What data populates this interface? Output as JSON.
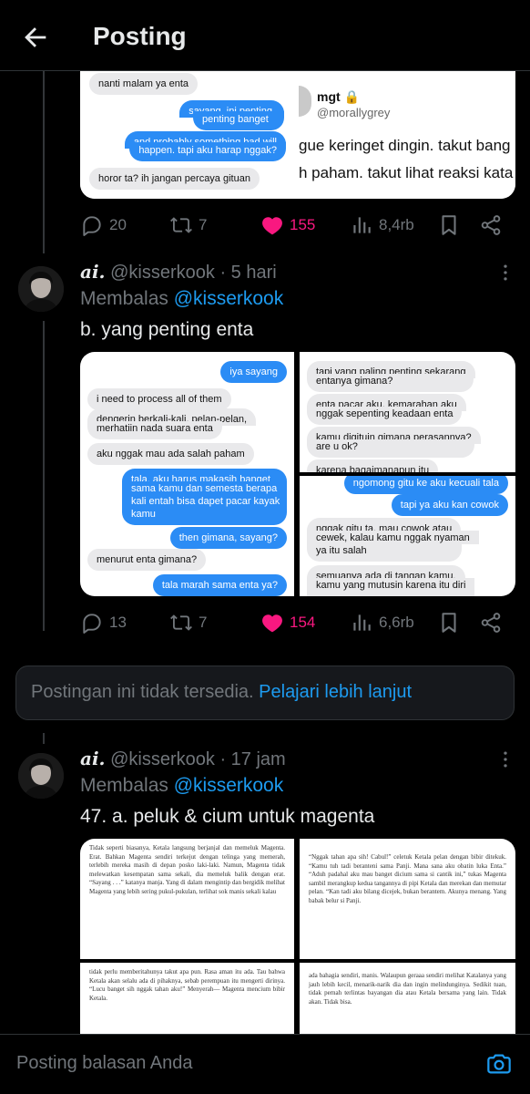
{
  "header": {
    "title": "Posting"
  },
  "post1": {
    "media_left": [
      {
        "side": "l",
        "text": "nanti malam ya enta"
      },
      {
        "side": "r",
        "text": "sayang, ini penting."
      },
      {
        "side": "r",
        "text": "penting banget"
      },
      {
        "side": "r",
        "text": "and probably something bad will"
      },
      {
        "side": "r",
        "text": "happen. tapi aku harap nggak?"
      },
      {
        "side": "l",
        "text": "horor ta? ih jangan percaya gituan"
      }
    ],
    "media_right": {
      "name": "mgt",
      "handle": "@morallygrey",
      "line1": "gue keringet dingin. takut bang",
      "line2": "h paham. takut lihat reaksi kata"
    },
    "replies": "20",
    "reposts": "7",
    "likes": "155",
    "views": "8,4rb"
  },
  "post2": {
    "name": "ai.",
    "handle": "@kisserkook",
    "time": "· 5 hari",
    "reply_label": "Membalas",
    "reply_mention": "@kisserkook",
    "text": "b. yang penting enta",
    "media_left": [
      {
        "side": "r",
        "text": "iya sayang"
      },
      {
        "side": "l",
        "text": "i need to process all of them"
      },
      {
        "side": "l",
        "text": "dengerin berkali-kali, pelan-pelan,"
      },
      {
        "side": "l",
        "text": "merhatiin nada suara enta"
      },
      {
        "side": "l",
        "text": "aku nggak mau ada salah paham"
      },
      {
        "side": "r",
        "text": "tala, aku harus makasih banget"
      },
      {
        "side": "r",
        "text": "sama kamu dan semesta berapa"
      },
      {
        "side": "r",
        "text": "kali entah bisa dapet pacar kayak"
      },
      {
        "side": "r",
        "text": "kamu"
      },
      {
        "side": "r",
        "text": "then gimana, sayang?"
      },
      {
        "side": "l",
        "text": "menurut enta gimana?"
      },
      {
        "side": "r",
        "text": "tala marah sama enta ya?"
      }
    ],
    "media_right_top": [
      {
        "side": "l",
        "text": "tapi yang paling penting sekarang"
      },
      {
        "side": "l",
        "text": "entanya gimana?"
      },
      {
        "side": "l",
        "text": "enta pacar aku, kemarahan aku"
      },
      {
        "side": "l",
        "text": "nggak sepenting keadaan enta"
      },
      {
        "side": "l",
        "text": "kamu digituin gimana perasannya?"
      },
      {
        "side": "l",
        "text": "are u ok?"
      },
      {
        "side": "l",
        "text": "karena bagaimanapun itu"
      }
    ],
    "media_right_bottom": [
      {
        "side": "r",
        "text": "ngomong gitu ke aku kecuali tala"
      },
      {
        "side": "r",
        "text": "tapi ya aku kan cowok"
      },
      {
        "side": "l",
        "text": "nggak gitu ta, mau cowok atau"
      },
      {
        "side": "l",
        "text": "cewek, kalau kamu nggak nyaman"
      },
      {
        "side": "l",
        "text": "ya itu salah"
      },
      {
        "side": "l",
        "text": "semuanya ada di tangan kamu."
      },
      {
        "side": "l",
        "text": "kamu yang mutusin karena itu diri"
      }
    ],
    "replies": "13",
    "reposts": "7",
    "likes": "154",
    "views": "6,6rb"
  },
  "unavailable": {
    "text": "Postingan ini tidak tersedia.",
    "link": "Pelajari lebih lanjut"
  },
  "post3": {
    "name": "ai.",
    "handle": "@kisserkook",
    "time": "· 17 jam",
    "reply_label": "Membalas",
    "reply_mention": "@kisserkook",
    "text": "47. a. peluk & cium untuk magenta",
    "page1": "Tidak seperti biasanya, Ketala langsung berjanjal dan memeluk Magenta. Erat. Bahkan Magenta sendiri terkejut dengan telinga yang memerah, terlebih mereka masih di depan posko laki-laki. Namun, Magenta tidak melewatkan kesempatan sama sekali, dia memeluk balik dengan erat. “Sayang . . .” katanya manja. Yang di dalam mengintip dan bergidik melihat Magenta yang lebih sering pukul-pukulan, terlihat sok manis sekali kalau",
    "page2": "“Nggak tahan apa sih! Cabul!” celetuk Ketala pelan dengan bibir ditekuk. “Kamu tuh tadi beranteni sama Panji. Mana sana aku obatin luka Enta.” “Aduh padahal aku mau banget dicium sama si cantik ini,” tukas Magenta sambil merangkup kedua tangannya di pipi Ketala dan merekan dan memutar pelan. “Kan tadi aku bilang dicejek, bukan berantem. Akunya menang. Yang babak belur si Panji.",
    "page3": "tidak perlu memberitahunya takut apa pun. Rasa aman itu ada. Tau bahwa Ketala akan selalu ada di pihaknya, sebab perempuan itu mengerti dirinya. “Lucu banget sih nggak tahan aku!” Menyerah— Magenta mencium bibir Ketala.",
    "page4": "ada bahagia sendiri, manis. Walaupun geraaa sendiri melihat Katalanya yang jauh lebih kecil, menarik-narik dia dan ingin melindunginya. Sedikit tuan, tidak pernah terlintas bayangan dia atau Ketala bersama yang lain. Tidak akan. Tidak bisa."
  },
  "composer": {
    "placeholder": "Posting balasan Anda"
  }
}
